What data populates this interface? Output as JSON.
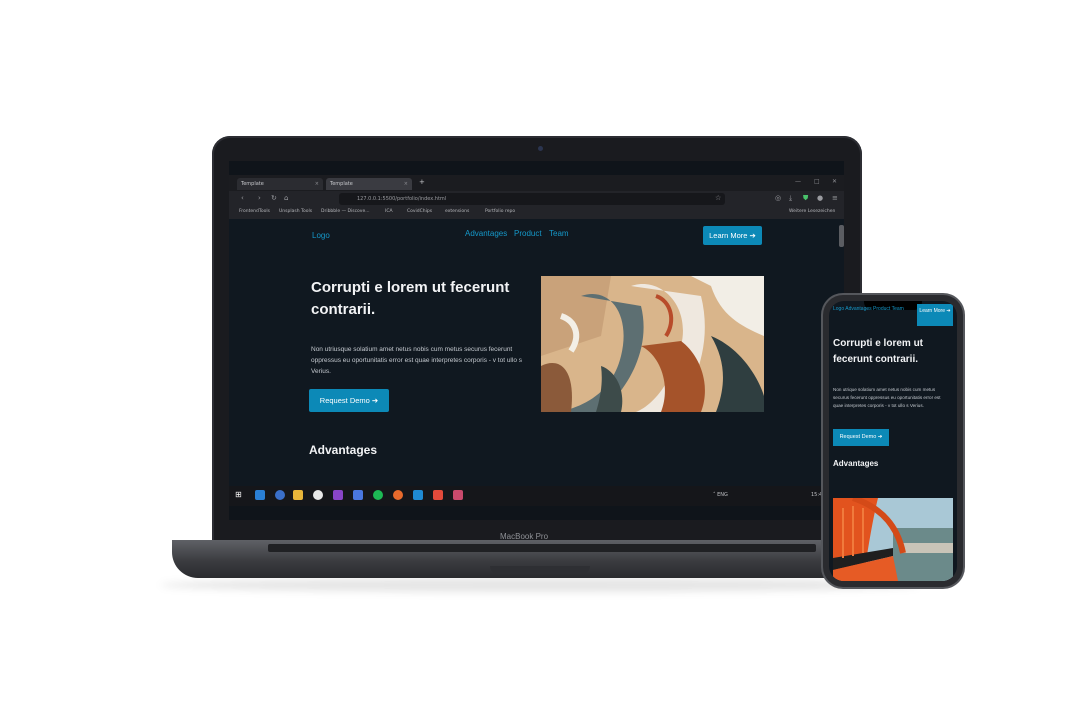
{
  "laptop": {
    "brand_label": "MacBook Pro",
    "browser": {
      "tabs": [
        "Template",
        "Template"
      ],
      "url": "127.0.0.1:5500/portfolio/index.html",
      "bookmarks": [
        "FrontendTools",
        "Unsplash Tools",
        "Dribbble — Discove...",
        "ICA",
        "CovidChips",
        "extensions",
        "Portfolio repo"
      ],
      "bookmarks_right": "Weitere Lesezeichen"
    },
    "page": {
      "logo": "Logo",
      "nav": [
        "Advantages",
        "Product",
        "Team"
      ],
      "learn_button": "Learn More ➔",
      "hero_title": "Corrupti e lorem ut fecerunt contrarii.",
      "hero_text": "Non utriusque solatium amet netus nobis cum metus securus fecerunt oppressus eu oportunitatis error est quae interpretes corporis - v tot ullo s Verius.",
      "demo_button": "Request Demo ➔",
      "section_title": "Advantages"
    },
    "taskbar": {
      "tray_text": "˄ ENG",
      "time": "15:47"
    }
  },
  "phone": {
    "nav_text": "Logo Advantages Product Team",
    "learn_button": "Learn More ➔",
    "hero_title": "Corrupti e lorem ut fecerunt contrarii.",
    "hero_text": "Non utrique solatium amet netus nobis cum metus securus fecerunt oppressus eu oportunitatis error est quae interpretes corporis - v tot ullo s Verius.",
    "demo_button": "Request Demo ➔",
    "section_title": "Advantages"
  },
  "colors": {
    "accent": "#0c89b7",
    "link": "#1598c9",
    "page_bg": "#101820"
  }
}
